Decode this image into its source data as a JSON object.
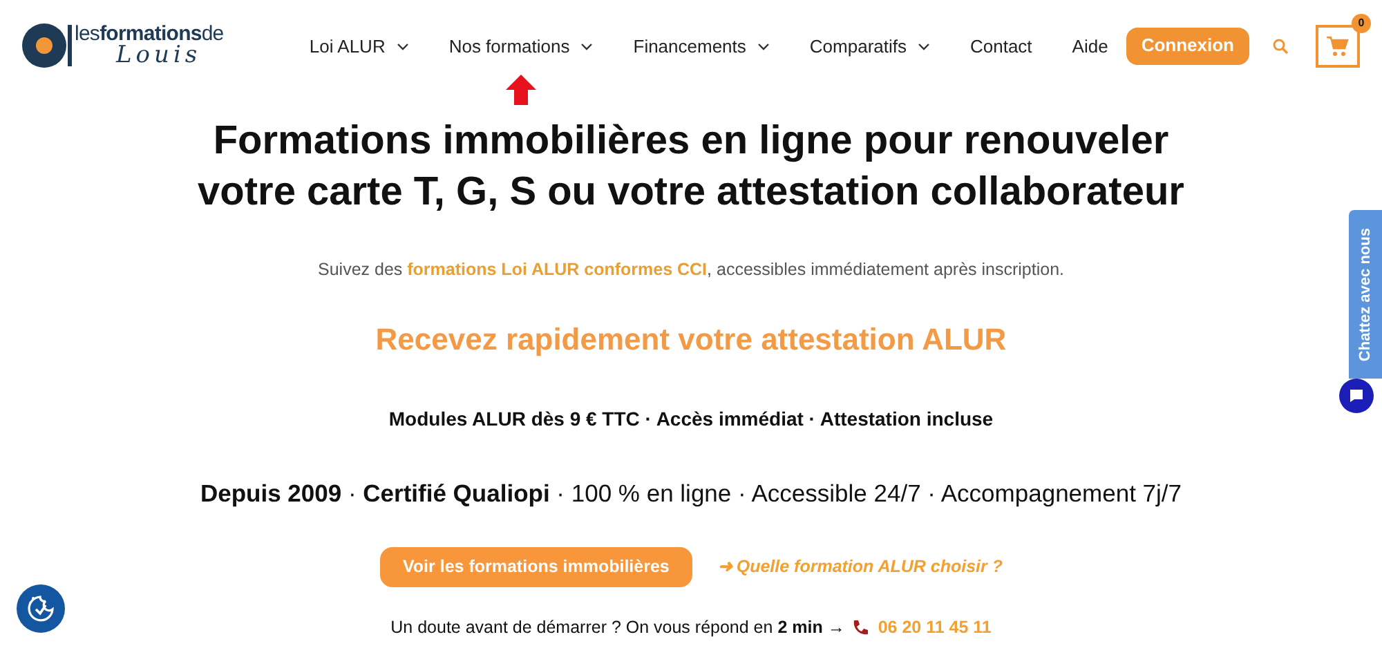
{
  "logo": {
    "top": "les**formations**de",
    "bottom": "Louis"
  },
  "nav": [
    {
      "label": "Loi ALUR",
      "dropdown": true,
      "pointed": false
    },
    {
      "label": "Nos formations",
      "dropdown": true,
      "pointed": true
    },
    {
      "label": "Financements",
      "dropdown": true,
      "pointed": false
    },
    {
      "label": "Comparatifs",
      "dropdown": true,
      "pointed": false
    },
    {
      "label": "Contact",
      "dropdown": false,
      "pointed": false
    },
    {
      "label": "Aide",
      "dropdown": false,
      "pointed": false
    }
  ],
  "login_button": "Connexion",
  "cart_count": "0",
  "hero": {
    "title": "Formations immobilières en ligne pour renouveler votre carte T, G, S ou votre attestation collaborateur",
    "intro": "Suivez des **formations Loi ALUR conformes CCI**, accessibles immédiatement après inscription.",
    "subtitle": "Recevez rapidement votre attestation ALUR",
    "offer": "Modules ALUR dès 9 € TTC · Accès immédiat · Attestation incluse",
    "trust": "**Depuis 2009** · **Certifié Qualiopi** · 100 % en ligne · Accessible 24/7 · Accompagnement 7j/7",
    "cta": "Voir les formations immobilières",
    "link": "➜ Quelle formation ALUR choisir ?",
    "contact": "Un doute avant de démarrer ? On vous répond en **2 min** →",
    "phone": "06 20 11 45 11"
  },
  "chat_tab": "Chattez avec nous"
}
